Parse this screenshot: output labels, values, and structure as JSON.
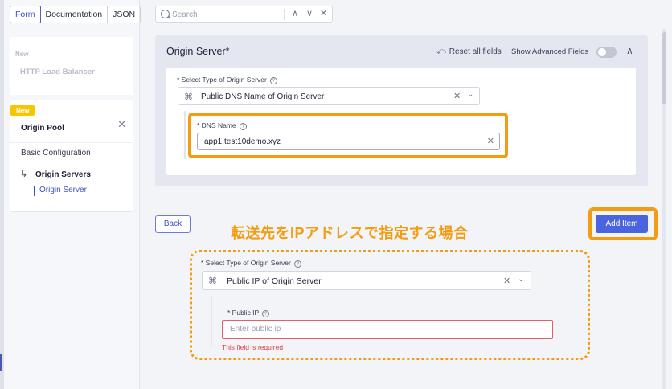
{
  "tabs": {
    "form": "Form",
    "documentation": "Documentation",
    "json": "JSON"
  },
  "search": {
    "placeholder": "Search",
    "up": "∧",
    "down": "∨",
    "close": "✕"
  },
  "sidebar": {
    "lb_tag": "New",
    "lb_name": "HTTP Load Balancer",
    "pool_badge": "New",
    "pool_title": "Origin Pool",
    "pool_close": "✕",
    "basic": "Basic Configuration",
    "arrow": "↳",
    "servers": "Origin Servers",
    "server": "Origin Server"
  },
  "section": {
    "title": "Origin Server*",
    "reset_icon": "⤺",
    "reset": "Reset all fields",
    "show_advanced": "Show Advanced Fields",
    "collapse": "∧",
    "type_label": "* Select Type of Origin Server",
    "type_value": "Public DNS Name of Origin Server",
    "dns_label": "* DNS Name",
    "dns_value": "app1.test10demo.xyz"
  },
  "actions": {
    "back": "Back",
    "add_item": "Add Item"
  },
  "annotation": {
    "note": "転送先をIPアドレスで指定する場合"
  },
  "alt": {
    "type_label": "* Select Type of Origin Server",
    "type_value": "Public IP of Origin Server",
    "ip_label": "* Public IP",
    "ip_placeholder": "Enter public ip",
    "error": "This field is required"
  },
  "icons": {
    "help": "?",
    "clear": "✕",
    "chevron": "⌄",
    "type_icon": "⌘"
  },
  "colors": {
    "accent": "#3d52c5",
    "highlight": "#f39c12",
    "primary_button": "#4a64e0",
    "error": "#e0404a"
  }
}
